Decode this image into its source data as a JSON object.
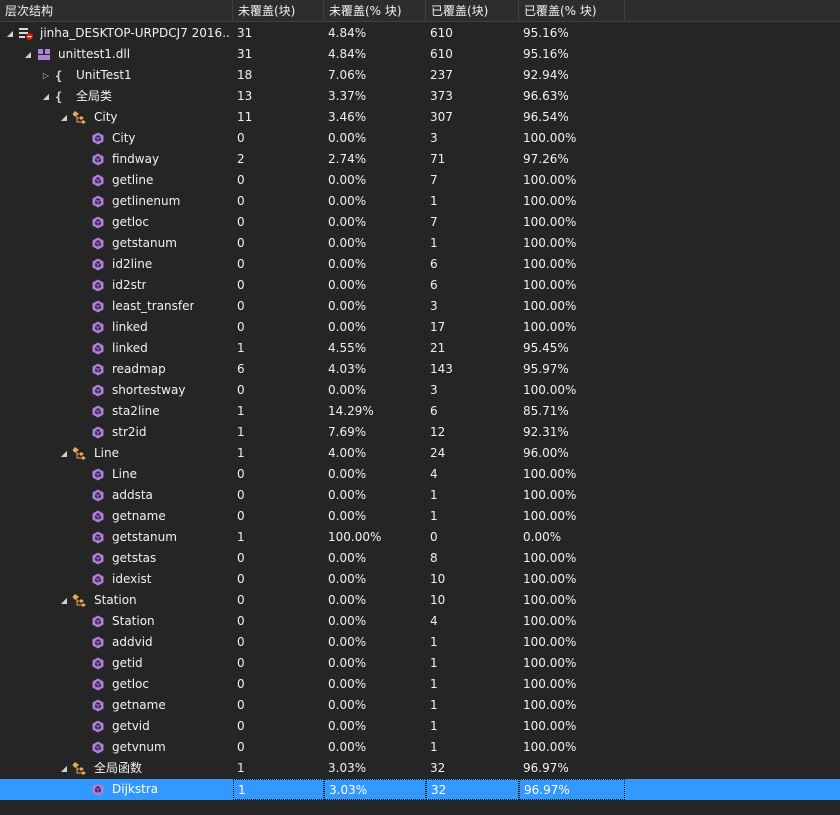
{
  "window": {
    "title": ""
  },
  "columns": [
    {
      "key": "name",
      "label": "层次结构"
    },
    {
      "key": "nc_blocks",
      "label": "未覆盖(块)"
    },
    {
      "key": "nc_pct",
      "label": "未覆盖(% 块)"
    },
    {
      "key": "c_blocks",
      "label": "已覆盖(块)"
    },
    {
      "key": "c_pct",
      "label": "已覆盖(% 块)"
    }
  ],
  "colors": {
    "background": "#252526",
    "header": "#2d2d30",
    "selection": "#3399ff",
    "method_icon": "#b180d7",
    "class_icon": "#e8ab53",
    "namespace_icon": "#d7d7d7"
  },
  "rows": [
    {
      "level": 0,
      "expander": "expanded",
      "icon": "coverage-result-icon",
      "name": "jinha_DESKTOP-URPDCJ7 2016...",
      "nc_blocks": "31",
      "nc_pct": "4.84%",
      "c_blocks": "610",
      "c_pct": "95.16%"
    },
    {
      "level": 1,
      "expander": "expanded",
      "icon": "assembly-icon",
      "name": "unittest1.dll",
      "nc_blocks": "31",
      "nc_pct": "4.84%",
      "c_blocks": "610",
      "c_pct": "95.16%"
    },
    {
      "level": 2,
      "expander": "collapsed",
      "icon": "namespace-icon",
      "name": "UnitTest1",
      "nc_blocks": "18",
      "nc_pct": "7.06%",
      "c_blocks": "237",
      "c_pct": "92.94%"
    },
    {
      "level": 2,
      "expander": "expanded",
      "icon": "namespace-icon",
      "name": "全局类",
      "nc_blocks": "13",
      "nc_pct": "3.37%",
      "c_blocks": "373",
      "c_pct": "96.63%"
    },
    {
      "level": 3,
      "expander": "expanded",
      "icon": "class-icon",
      "name": "City",
      "nc_blocks": "11",
      "nc_pct": "3.46%",
      "c_blocks": "307",
      "c_pct": "96.54%"
    },
    {
      "level": 4,
      "expander": "none",
      "icon": "method-icon",
      "name": "City",
      "nc_blocks": "0",
      "nc_pct": "0.00%",
      "c_blocks": "3",
      "c_pct": "100.00%"
    },
    {
      "level": 4,
      "expander": "none",
      "icon": "method-icon",
      "name": "findway",
      "nc_blocks": "2",
      "nc_pct": "2.74%",
      "c_blocks": "71",
      "c_pct": "97.26%"
    },
    {
      "level": 4,
      "expander": "none",
      "icon": "method-icon",
      "name": "getline",
      "nc_blocks": "0",
      "nc_pct": "0.00%",
      "c_blocks": "7",
      "c_pct": "100.00%"
    },
    {
      "level": 4,
      "expander": "none",
      "icon": "method-icon",
      "name": "getlinenum",
      "nc_blocks": "0",
      "nc_pct": "0.00%",
      "c_blocks": "1",
      "c_pct": "100.00%"
    },
    {
      "level": 4,
      "expander": "none",
      "icon": "method-icon",
      "name": "getloc",
      "nc_blocks": "0",
      "nc_pct": "0.00%",
      "c_blocks": "7",
      "c_pct": "100.00%"
    },
    {
      "level": 4,
      "expander": "none",
      "icon": "method-icon",
      "name": "getstanum",
      "nc_blocks": "0",
      "nc_pct": "0.00%",
      "c_blocks": "1",
      "c_pct": "100.00%"
    },
    {
      "level": 4,
      "expander": "none",
      "icon": "method-icon",
      "name": "id2line",
      "nc_blocks": "0",
      "nc_pct": "0.00%",
      "c_blocks": "6",
      "c_pct": "100.00%"
    },
    {
      "level": 4,
      "expander": "none",
      "icon": "method-icon",
      "name": "id2str",
      "nc_blocks": "0",
      "nc_pct": "0.00%",
      "c_blocks": "6",
      "c_pct": "100.00%"
    },
    {
      "level": 4,
      "expander": "none",
      "icon": "method-icon",
      "name": "least_transfer",
      "nc_blocks": "0",
      "nc_pct": "0.00%",
      "c_blocks": "3",
      "c_pct": "100.00%"
    },
    {
      "level": 4,
      "expander": "none",
      "icon": "method-icon",
      "name": "linked",
      "nc_blocks": "0",
      "nc_pct": "0.00%",
      "c_blocks": "17",
      "c_pct": "100.00%"
    },
    {
      "level": 4,
      "expander": "none",
      "icon": "method-icon",
      "name": "linked",
      "nc_blocks": "1",
      "nc_pct": "4.55%",
      "c_blocks": "21",
      "c_pct": "95.45%"
    },
    {
      "level": 4,
      "expander": "none",
      "icon": "method-icon",
      "name": "readmap",
      "nc_blocks": "6",
      "nc_pct": "4.03%",
      "c_blocks": "143",
      "c_pct": "95.97%"
    },
    {
      "level": 4,
      "expander": "none",
      "icon": "method-icon",
      "name": "shortestway",
      "nc_blocks": "0",
      "nc_pct": "0.00%",
      "c_blocks": "3",
      "c_pct": "100.00%"
    },
    {
      "level": 4,
      "expander": "none",
      "icon": "method-icon",
      "name": "sta2line",
      "nc_blocks": "1",
      "nc_pct": "14.29%",
      "c_blocks": "6",
      "c_pct": "85.71%"
    },
    {
      "level": 4,
      "expander": "none",
      "icon": "method-icon",
      "name": "str2id",
      "nc_blocks": "1",
      "nc_pct": "7.69%",
      "c_blocks": "12",
      "c_pct": "92.31%"
    },
    {
      "level": 3,
      "expander": "expanded",
      "icon": "class-icon",
      "name": "Line",
      "nc_blocks": "1",
      "nc_pct": "4.00%",
      "c_blocks": "24",
      "c_pct": "96.00%"
    },
    {
      "level": 4,
      "expander": "none",
      "icon": "method-icon",
      "name": "Line",
      "nc_blocks": "0",
      "nc_pct": "0.00%",
      "c_blocks": "4",
      "c_pct": "100.00%"
    },
    {
      "level": 4,
      "expander": "none",
      "icon": "method-icon",
      "name": "addsta",
      "nc_blocks": "0",
      "nc_pct": "0.00%",
      "c_blocks": "1",
      "c_pct": "100.00%"
    },
    {
      "level": 4,
      "expander": "none",
      "icon": "method-icon",
      "name": "getname",
      "nc_blocks": "0",
      "nc_pct": "0.00%",
      "c_blocks": "1",
      "c_pct": "100.00%"
    },
    {
      "level": 4,
      "expander": "none",
      "icon": "method-icon",
      "name": "getstanum",
      "nc_blocks": "1",
      "nc_pct": "100.00%",
      "c_blocks": "0",
      "c_pct": "0.00%"
    },
    {
      "level": 4,
      "expander": "none",
      "icon": "method-icon",
      "name": "getstas",
      "nc_blocks": "0",
      "nc_pct": "0.00%",
      "c_blocks": "8",
      "c_pct": "100.00%"
    },
    {
      "level": 4,
      "expander": "none",
      "icon": "method-icon",
      "name": "idexist",
      "nc_blocks": "0",
      "nc_pct": "0.00%",
      "c_blocks": "10",
      "c_pct": "100.00%"
    },
    {
      "level": 3,
      "expander": "expanded",
      "icon": "class-icon",
      "name": "Station",
      "nc_blocks": "0",
      "nc_pct": "0.00%",
      "c_blocks": "10",
      "c_pct": "100.00%"
    },
    {
      "level": 4,
      "expander": "none",
      "icon": "method-icon",
      "name": "Station",
      "nc_blocks": "0",
      "nc_pct": "0.00%",
      "c_blocks": "4",
      "c_pct": "100.00%"
    },
    {
      "level": 4,
      "expander": "none",
      "icon": "method-icon",
      "name": "addvid",
      "nc_blocks": "0",
      "nc_pct": "0.00%",
      "c_blocks": "1",
      "c_pct": "100.00%"
    },
    {
      "level": 4,
      "expander": "none",
      "icon": "method-icon",
      "name": "getid",
      "nc_blocks": "0",
      "nc_pct": "0.00%",
      "c_blocks": "1",
      "c_pct": "100.00%"
    },
    {
      "level": 4,
      "expander": "none",
      "icon": "method-icon",
      "name": "getloc",
      "nc_blocks": "0",
      "nc_pct": "0.00%",
      "c_blocks": "1",
      "c_pct": "100.00%"
    },
    {
      "level": 4,
      "expander": "none",
      "icon": "method-icon",
      "name": "getname",
      "nc_blocks": "0",
      "nc_pct": "0.00%",
      "c_blocks": "1",
      "c_pct": "100.00%"
    },
    {
      "level": 4,
      "expander": "none",
      "icon": "method-icon",
      "name": "getvid",
      "nc_blocks": "0",
      "nc_pct": "0.00%",
      "c_blocks": "1",
      "c_pct": "100.00%"
    },
    {
      "level": 4,
      "expander": "none",
      "icon": "method-icon",
      "name": "getvnum",
      "nc_blocks": "0",
      "nc_pct": "0.00%",
      "c_blocks": "1",
      "c_pct": "100.00%"
    },
    {
      "level": 3,
      "expander": "expanded",
      "icon": "class-icon",
      "name": "全局函数",
      "nc_blocks": "1",
      "nc_pct": "3.03%",
      "c_blocks": "32",
      "c_pct": "96.97%"
    },
    {
      "level": 4,
      "expander": "none",
      "icon": "method-icon",
      "name": "Dijkstra",
      "nc_blocks": "1",
      "nc_pct": "3.03%",
      "c_blocks": "32",
      "c_pct": "96.97%",
      "selected": true
    }
  ]
}
